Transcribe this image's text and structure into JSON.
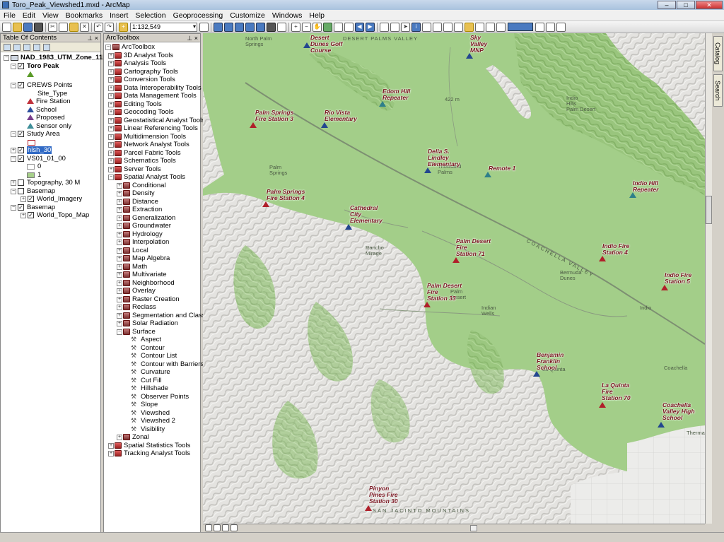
{
  "window": {
    "title": "Toro_Peak_Viewshed1.mxd - ArcMap"
  },
  "menu": [
    "File",
    "Edit",
    "View",
    "Bookmarks",
    "Insert",
    "Selection",
    "Geoprocessing",
    "Customize",
    "Windows",
    "Help"
  ],
  "toolbar": {
    "scale": "1:132,549"
  },
  "toc": {
    "title": "Table Of Contents",
    "pins": "⊥ ×",
    "items": {
      "df": "NAD_1983_UTM_Zone_11N",
      "toro": "Toro Peak",
      "crews": "CREWS Points",
      "site_type": "Site_Type",
      "fire": "Fire Station",
      "school": "School",
      "proposed": "Proposed",
      "sensor": "Sensor only",
      "study": "Study Area",
      "hlsh": "hlsh_30",
      "vs": "VS01_01_00",
      "v0": "0",
      "v1": "1",
      "topo": "Topography, 30 M",
      "basemap1": "Basemap",
      "imagery": "World_Imagery",
      "basemap2": "Basemap",
      "topomap": "World_Topo_Map"
    }
  },
  "toolbox": {
    "title": "ArcToolbox",
    "pins": "⊥ ×",
    "root": "ArcToolbox",
    "sets": [
      "3D Analyst Tools",
      "Analysis Tools",
      "Cartography Tools",
      "Conversion Tools",
      "Data Interoperability Tools",
      "Data Management Tools",
      "Editing Tools",
      "Geocoding Tools",
      "Geostatistical Analyst Tools",
      "Linear Referencing Tools",
      "Multidimension Tools",
      "Network Analyst Tools",
      "Parcel Fabric Tools",
      "Schematics Tools",
      "Server Tools",
      "Spatial Analyst Tools"
    ],
    "spatial": [
      "Conditional",
      "Density",
      "Distance",
      "Extraction",
      "Generalization",
      "Groundwater",
      "Hydrology",
      "Interpolation",
      "Local",
      "Map Algebra",
      "Math",
      "Multivariate",
      "Neighborhood",
      "Overlay",
      "Raster Creation",
      "Reclass",
      "Segmentation and Classification",
      "Solar Radiation",
      "Surface"
    ],
    "surface": [
      "Aspect",
      "Contour",
      "Contour List",
      "Contour with Barriers",
      "Curvature",
      "Cut Fill",
      "Hillshade",
      "Observer Points",
      "Slope",
      "Viewshed",
      "Viewshed 2",
      "Visibility"
    ],
    "after": [
      "Zonal"
    ],
    "tail": [
      "Spatial Statistics Tools",
      "Tracking Analyst Tools"
    ]
  },
  "map": {
    "labels": {
      "desert_dunes": "Desert\nDunes Golf\nCourse",
      "sky_valley": "Sky\nValley\nMNP",
      "edom_hill": "Edom Hill\nRepeater",
      "ps3": "Palm Springs\nFire Station 3",
      "rio_vista": "Rio Vista\nElementary",
      "della": "Della S.\nLindley\nElementary",
      "remote1": "Remote 1",
      "indio_hill": "Indio Hill\nRepeater",
      "ps4": "Palm Springs\nFire Station 4",
      "cathedral": "Cathedral\nCity\nElementary",
      "pd71": "Palm Desert\nFire\nStation 71",
      "indio4": "Indio Fire\nStation 4",
      "indio5": "Indio Fire\nStation 5",
      "pd33": "Palm Desert\nFire\nStation 33",
      "franklin": "Benjamin\nFranklin\nSchool",
      "lq70": "La Quinta\nFire\nStation 70",
      "cvhs": "Coachella\nValley High\nSchool",
      "pinyon": "Pinyon\nPines Fire\nStation 30"
    },
    "places": {
      "north_ps": "North Palm\nSprings",
      "palm_springs": "Palm\nSprings",
      "thousand_palms": "Thousand\nPalms",
      "indio_hills": "Indio\nHills\nPalm Desert",
      "rancho_mirage": "Rancho\nMirage",
      "bermuda_dunes": "Bermuda\nDunes",
      "indio": "Indio",
      "palm_desert": "Palm\nDesert",
      "indian_wells": "Indian\nWells",
      "la_quinta": "La Quinta",
      "coachella": "Coachella",
      "thermal": "Thermal",
      "desert_palms_valley": "DESERT PALMS VALLEY",
      "coachella_valley": "COACHELLA VALLEY",
      "san_jacinto": "SAN JACINTO MOUNTAINS",
      "elev": "422 m"
    }
  },
  "sidetabs": {
    "catalog": "Catalog",
    "search": "Search"
  }
}
